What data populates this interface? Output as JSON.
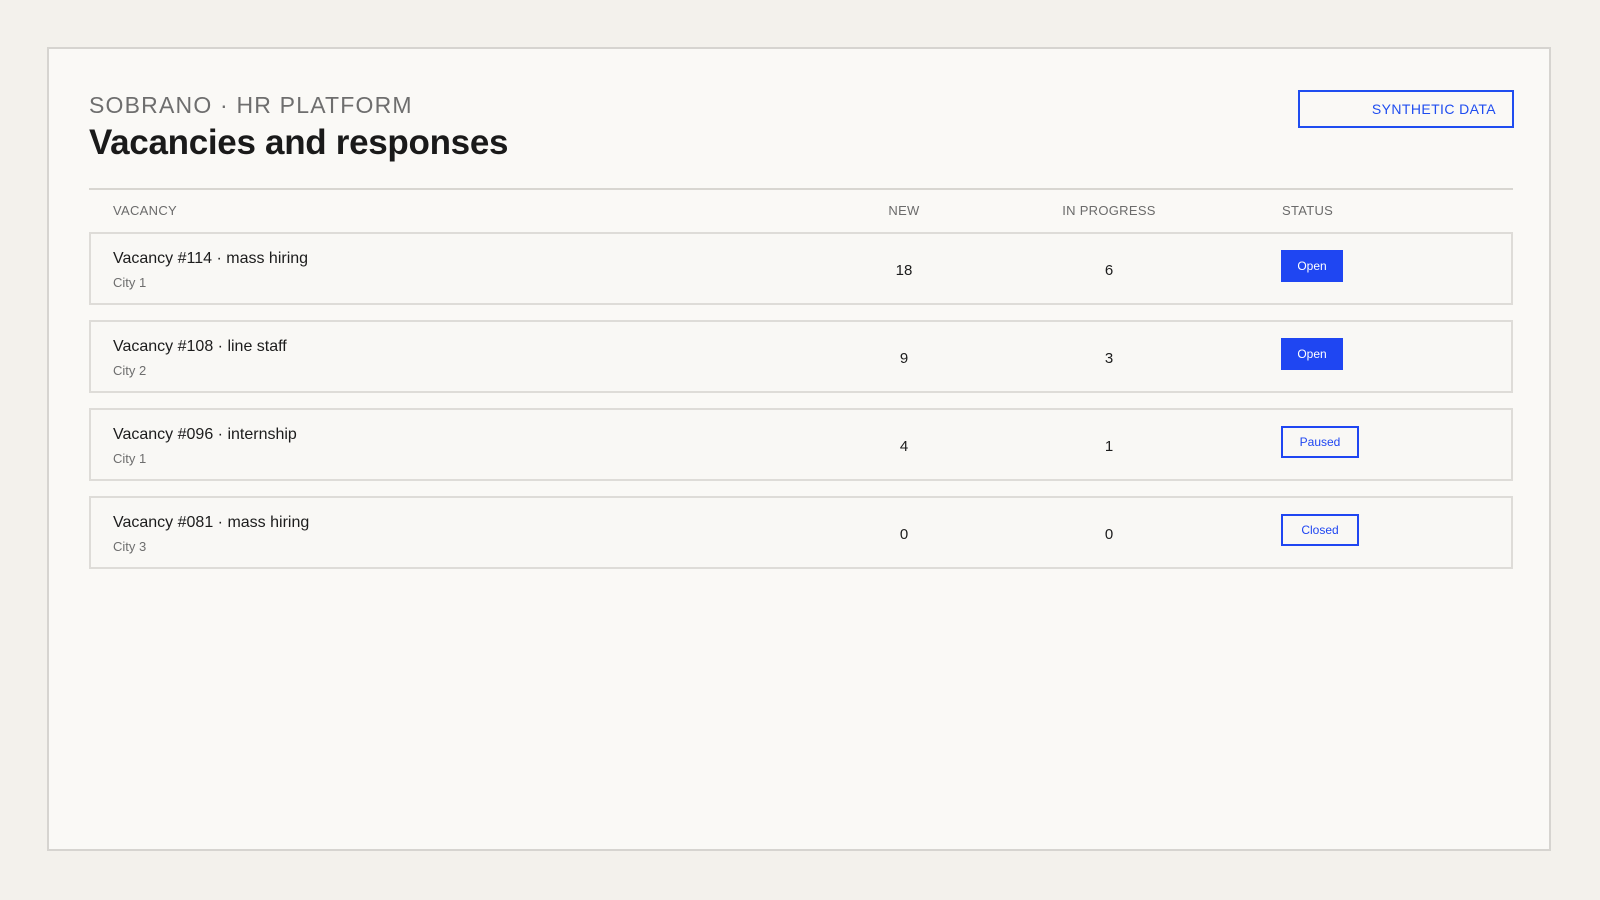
{
  "header": {
    "subtitle": "SOBRANO · HR PLATFORM",
    "title": "Vacancies and responses",
    "badge": "SYNTHETIC DATA"
  },
  "table": {
    "columns": {
      "vacancy": "VACANCY",
      "new": "NEW",
      "in_progress": "IN PROGRESS",
      "status": "STATUS"
    },
    "rows": [
      {
        "title": "Vacancy #114 · mass hiring",
        "city": "City 1",
        "new": "18",
        "in_progress": "6",
        "status": "Open"
      },
      {
        "title": "Vacancy #108 · line staff",
        "city": "City 2",
        "new": "9",
        "in_progress": "3",
        "status": "Open"
      },
      {
        "title": "Vacancy #096 · internship",
        "city": "City 1",
        "new": "4",
        "in_progress": "1",
        "status": "Paused"
      },
      {
        "title": "Vacancy #081 · mass hiring",
        "city": "City 3",
        "new": "0",
        "in_progress": "0",
        "status": "Closed"
      }
    ]
  },
  "colors": {
    "accent": "#1f46f2",
    "background": "#f3f1ec",
    "panel": "#faf9f6"
  }
}
